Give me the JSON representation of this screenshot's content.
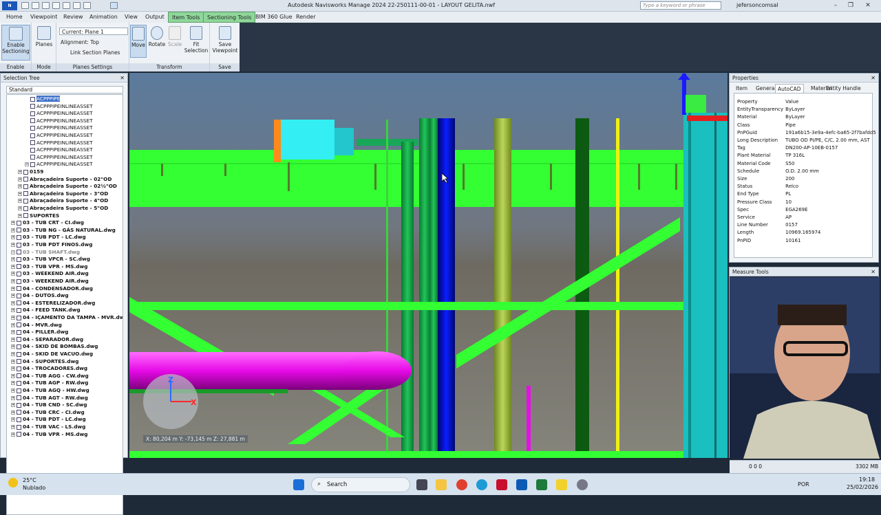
{
  "titlebar": {
    "logo": "N MAN",
    "title": "Autodesk Navisworks Manage 2024   22-250111-00-01 - LAYOUT GELITA.nwf",
    "search_placeholder": "Type a keyword or phrase",
    "user": "jefersoncomsal",
    "win_min": "–",
    "win_max": "❐",
    "win_close": "✕"
  },
  "menu": {
    "items": [
      "Home",
      "Viewpoint",
      "Review",
      "Animation",
      "View",
      "Output",
      "Item Tools",
      "Sectioning Tools",
      "BIM 360 Glue",
      "Render"
    ]
  },
  "ribbon": {
    "enable_label": "Enable Sectioning",
    "planes_label": "Planes",
    "current_plane": "Current: Plane 1",
    "alignment": "Alignment: Top",
    "link_planes": "Link Section Planes",
    "move": "Move",
    "rotate": "Rotate",
    "scale": "Scale",
    "fit_selection": "Fit Selection",
    "save_viewpoint": "Save Viewpoint",
    "groups": {
      "enable": "Enable",
      "mode": "Mode",
      "planes_settings": "Planes Settings",
      "transform": "Transform",
      "save": "Save"
    }
  },
  "selection_tree": {
    "title": "Selection Tree",
    "mode": "Standard",
    "items": [
      {
        "label": "ACPPPIPE",
        "indent": 2,
        "kind": "file",
        "hl": true
      },
      {
        "label": "ACPPPIPEINLINEASSET",
        "indent": 2,
        "kind": "file"
      },
      {
        "label": "ACPPPIPEINLINEASSET",
        "indent": 2,
        "kind": "file"
      },
      {
        "label": "ACPPPIPEINLINEASSET",
        "indent": 2,
        "kind": "file"
      },
      {
        "label": "ACPPPIPEINLINEASSET",
        "indent": 2,
        "kind": "file"
      },
      {
        "label": "ACPPPIPEINLINEASSET",
        "indent": 2,
        "kind": "file"
      },
      {
        "label": "ACPPPIPEINLINEASSET",
        "indent": 2,
        "kind": "file"
      },
      {
        "label": "ACPPPIPEINLINEASSET",
        "indent": 2,
        "kind": "file"
      },
      {
        "label": "ACPPPIPEINLINEASSET",
        "indent": 2,
        "kind": "file"
      },
      {
        "label": "ACPPPIPEINLINEASSET",
        "indent": 2,
        "kind": "plus"
      },
      {
        "label": "0159",
        "indent": 1,
        "kind": "bold"
      },
      {
        "label": "Abraçadeira Suporte - 02\"OD",
        "indent": 1,
        "kind": "bold"
      },
      {
        "label": "Abraçadeira Suporte - 02½\"OD",
        "indent": 1,
        "kind": "bold"
      },
      {
        "label": "Abraçadeira Suporte - 3\"OD",
        "indent": 1,
        "kind": "bold"
      },
      {
        "label": "Abraçadeira Suporte - 4\"OD",
        "indent": 1,
        "kind": "bold"
      },
      {
        "label": "Abraçadeira Suporte - 5\"OD",
        "indent": 1,
        "kind": "bold"
      },
      {
        "label": "SUPORTES",
        "indent": 1,
        "kind": "bold"
      },
      {
        "label": "03 - TUB CRT - CI.dwg",
        "indent": 0,
        "kind": "bold"
      },
      {
        "label": "03 - TUB NG - GÁS NATURAL.dwg",
        "indent": 0,
        "kind": "bold"
      },
      {
        "label": "03 - TUB PDT - LC.dwg",
        "indent": 0,
        "kind": "bold"
      },
      {
        "label": "03 - TUB PDT FINOS.dwg",
        "indent": 0,
        "kind": "bold"
      },
      {
        "label": "03 - TUB SHAFT.dwg",
        "indent": 0,
        "kind": "grey"
      },
      {
        "label": "03 - TUB VPCR - SC.dwg",
        "indent": 0,
        "kind": "bold"
      },
      {
        "label": "03 - TUB VPR - MS.dwg",
        "indent": 0,
        "kind": "bold"
      },
      {
        "label": "03 - WEEKEND AIR.dwg",
        "indent": 0,
        "kind": "bold"
      },
      {
        "label": "03 - WEEKEND AIR.dwg",
        "indent": 0,
        "kind": "bold"
      },
      {
        "label": "04 - CONDENSADOR.dwg",
        "indent": 0,
        "kind": "bold"
      },
      {
        "label": "04 - DUTOS.dwg",
        "indent": 0,
        "kind": "bold"
      },
      {
        "label": "04 - ESTERELIZADOR.dwg",
        "indent": 0,
        "kind": "bold"
      },
      {
        "label": "04 - FEED TANK.dwg",
        "indent": 0,
        "kind": "bold"
      },
      {
        "label": "04 - IÇAMENTO DA TAMPA - MVR.dw",
        "indent": 0,
        "kind": "bold"
      },
      {
        "label": "04 - MVR.dwg",
        "indent": 0,
        "kind": "bold"
      },
      {
        "label": "04 - PILLER.dwg",
        "indent": 0,
        "kind": "bold"
      },
      {
        "label": "04 - SEPARADOR.dwg",
        "indent": 0,
        "kind": "bold"
      },
      {
        "label": "04 - SKID DE BOMBAS.dwg",
        "indent": 0,
        "kind": "bold"
      },
      {
        "label": "04 - SKID DE VACUO.dwg",
        "indent": 0,
        "kind": "bold"
      },
      {
        "label": "04 - SUPORTES.dwg",
        "indent": 0,
        "kind": "bold"
      },
      {
        "label": "04 - TROCADORES.dwg",
        "indent": 0,
        "kind": "bold"
      },
      {
        "label": "04 - TUB AGG - CW.dwg",
        "indent": 0,
        "kind": "bold"
      },
      {
        "label": "04 - TUB AGP - RW.dwg",
        "indent": 0,
        "kind": "bold"
      },
      {
        "label": "04 - TUB AGQ - HW.dwg",
        "indent": 0,
        "kind": "bold"
      },
      {
        "label": "04 - TUB AGT - RW.dwg",
        "indent": 0,
        "kind": "bold"
      },
      {
        "label": "04 - TUB CND - SC.dwg",
        "indent": 0,
        "kind": "bold"
      },
      {
        "label": "04 - TUB CRC - CI.dwg",
        "indent": 0,
        "kind": "bold"
      },
      {
        "label": "04 - TUB PDT - LC.dwg",
        "indent": 0,
        "kind": "bold"
      },
      {
        "label": "04 - TUB VAC - LS.dwg",
        "indent": 0,
        "kind": "bold"
      },
      {
        "label": "04 - TUB VPR - MS.dwg",
        "indent": 0,
        "kind": "bold"
      }
    ]
  },
  "viewport": {
    "coords": "X: 80,204 m  Y: -73,145 m  Z: 27,881 m",
    "axis_z": "Z",
    "axis_x": "X"
  },
  "properties": {
    "title": "Properties",
    "tabs": [
      "Item",
      "General",
      "AutoCAD",
      "Material",
      "Entity Handle"
    ],
    "header": [
      "Property",
      "Value"
    ],
    "rows": [
      [
        "EntityTransparency",
        "ByLayer"
      ],
      [
        "Material",
        "ByLayer"
      ],
      [
        "Class",
        "Pipe"
      ],
      [
        "PnPGuid",
        "191a6b15-3e9a-4efc-ba65-2f7bafdd5"
      ],
      [
        "Long Description",
        "TUBO OD PI/PE, C/C, 2.00 mm, AST"
      ],
      [
        "Tag",
        "DN200-AP-10EB-0157"
      ],
      [
        "Plant Material",
        "TP 316L"
      ],
      [
        "Material Code",
        "S50"
      ],
      [
        "Schedule",
        "O.D. 2.00 mm"
      ],
      [
        "Size",
        "200"
      ],
      [
        "Status",
        "Relco"
      ],
      [
        "End Type",
        "PL"
      ],
      [
        "Pressure Class",
        "10"
      ],
      [
        "Spec",
        "EGA269E"
      ],
      [
        "Service",
        "AP"
      ],
      [
        "Line Number",
        "0157"
      ],
      [
        "Length",
        "10969.165974"
      ],
      [
        "PnPID",
        "10161"
      ]
    ]
  },
  "measure_tools": {
    "title": "Measure Tools"
  },
  "status": {
    "memory": "3302 MB",
    "counts": "0  0  0"
  },
  "taskbar": {
    "weather_temp": "25°C",
    "weather_desc": "Nublado",
    "search": "Search",
    "lang": "POR",
    "time": "19:18",
    "date": "25/02/2026"
  },
  "colors": {
    "accent_green": "#33ff33",
    "pipe_blue": "#0014e6",
    "pipe_magenta": "#e60ae6",
    "selection_blue": "#3b6ec9"
  }
}
